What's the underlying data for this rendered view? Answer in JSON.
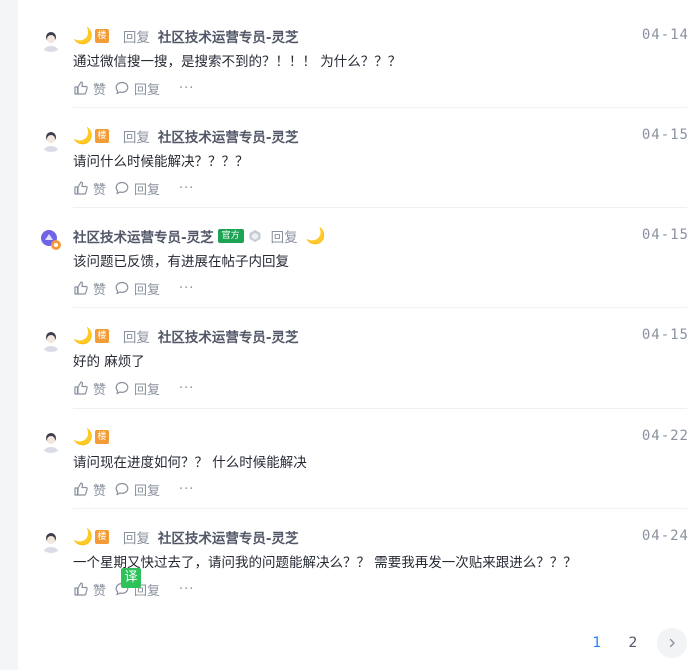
{
  "comments": [
    {
      "type": "reply",
      "reply_word": "回复",
      "target": "社区技术运营专员-灵芝",
      "date": "04-14",
      "content": "通过微信搜一搜，是搜索不到的？！！！ 为什么？？？"
    },
    {
      "type": "reply",
      "reply_word": "回复",
      "target": "社区技术运营专员-灵芝",
      "date": "04-15",
      "content": "请问什么时候能解决？？？？"
    },
    {
      "type": "official",
      "author": "社区技术运营专员-灵芝",
      "official_badge": "官方",
      "reply_word": "回复",
      "date": "04-15",
      "content": "该问题已反馈，有进展在帖子内回复"
    },
    {
      "type": "reply",
      "reply_word": "回复",
      "target": "社区技术运营专员-灵芝",
      "date": "04-15",
      "content": "好的 麻烦了"
    },
    {
      "type": "plain",
      "date": "04-22",
      "content": "请问现在进度如何？？ 什么时候能解决"
    },
    {
      "type": "reply",
      "reply_word": "回复",
      "target": "社区技术运营专员-灵芝",
      "date": "04-24",
      "content": "一个星期又快过去了，请问我的问题能解决么？？ 需要我再发一次贴来跟进么？？？"
    }
  ],
  "ui": {
    "moon_glyph": "🌙",
    "floor_badge": "楼",
    "like_label": "赞",
    "reply_label": "回复",
    "more_label": "···",
    "translate_label": "译"
  },
  "pagination": {
    "pages": [
      "1",
      "2"
    ],
    "current": "1"
  },
  "colors": {
    "accent": "#1e80ff",
    "floor_badge": "#f39b36",
    "official_badge": "#1fa354",
    "translate": "#2ec25b"
  }
}
